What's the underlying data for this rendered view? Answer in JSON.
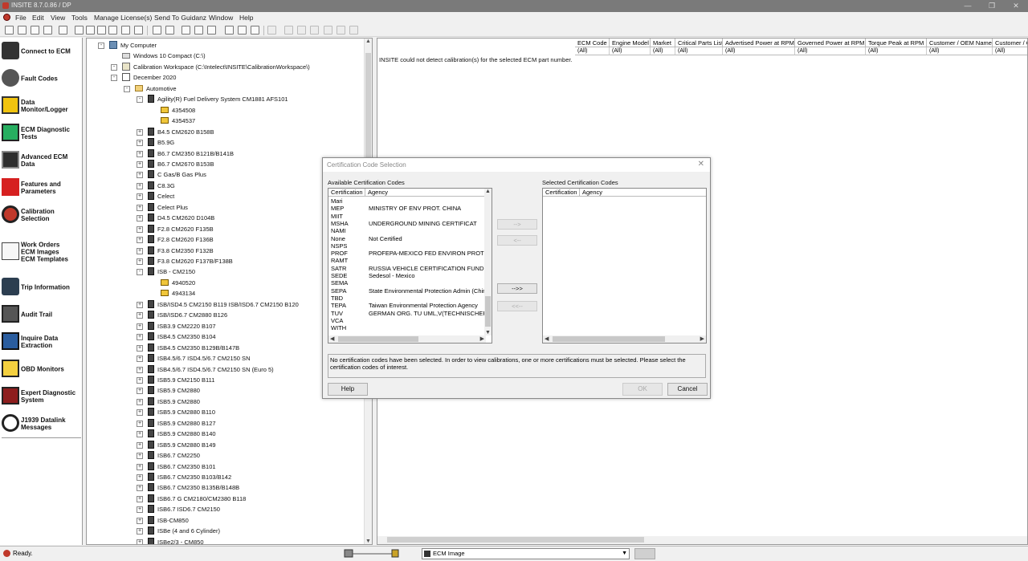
{
  "window": {
    "title": "INSITE 8.7.0.86 / DP",
    "controls": [
      "—",
      "❐",
      "✕"
    ]
  },
  "menu": [
    "File",
    "Edit",
    "View",
    "Tools",
    "Manage License(s)",
    "Send To Guidanz",
    "Window",
    "Help"
  ],
  "sidebar": [
    {
      "label": "Connect to ECM",
      "icon": "connect-ecm-icon"
    },
    {
      "label": "Fault Codes",
      "icon": "fault-codes-icon"
    },
    {
      "label": "Data\nMonitor/Logger",
      "icon": "data-monitor-icon"
    },
    {
      "label": "ECM Diagnostic\nTests",
      "icon": "ecm-diagnostic-icon"
    },
    {
      "label": "Advanced ECM\nData",
      "icon": "advanced-ecm-icon"
    },
    {
      "label": "Features and\nParameters",
      "icon": "features-icon"
    },
    {
      "label": "Calibration\nSelection",
      "icon": "calibration-icon"
    },
    {
      "label": "Work Orders\nECM Images\nECM Templates",
      "icon": "work-orders-icon"
    },
    {
      "label": "Trip Information",
      "icon": "trip-info-icon"
    },
    {
      "label": "Audit Trail",
      "icon": "audit-trail-icon"
    },
    {
      "label": "Inquire Data\nExtraction",
      "icon": "inquire-data-icon"
    },
    {
      "label": "OBD Monitors",
      "icon": "obd-monitors-icon"
    },
    {
      "label": "Expert Diagnostic\nSystem",
      "icon": "expert-diagnostic-icon"
    },
    {
      "label": "J1939 Datalink\nMessages",
      "icon": "j1939-icon"
    }
  ],
  "tree": [
    {
      "label": "My Computer",
      "level": 0,
      "icon": "comp",
      "exp": "-"
    },
    {
      "label": "Windows 10 Compact  (C:\\)",
      "level": 1,
      "icon": "drive",
      "exp": ""
    },
    {
      "label": "Calibration Workspace  (C:\\Intelect\\INSITE\\CalibrationWorkspace\\)",
      "level": 1,
      "icon": "ws",
      "exp": "-"
    },
    {
      "label": "December 2020",
      "level": 2,
      "icon": "cal",
      "exp": "-"
    },
    {
      "label": "Automotive",
      "level": 3,
      "icon": "folder",
      "exp": "-"
    },
    {
      "label": "Agility(R) Fuel Delivery System CM1881 AFS101",
      "level": 4,
      "icon": "ecm",
      "exp": "-"
    },
    {
      "label": "4354508",
      "level": 5,
      "icon": "file",
      "exp": ""
    },
    {
      "label": "4354537",
      "level": 5,
      "icon": "file",
      "exp": ""
    },
    {
      "label": "B4.5 CM2620 B158B",
      "level": 4,
      "icon": "ecm",
      "exp": "+"
    },
    {
      "label": "B5.9G",
      "level": 4,
      "icon": "ecm",
      "exp": "+"
    },
    {
      "label": "B6.7 CM2350 B121B/B141B",
      "level": 4,
      "icon": "ecm",
      "exp": "+"
    },
    {
      "label": "B6.7 CM2670 B153B",
      "level": 4,
      "icon": "ecm",
      "exp": "+"
    },
    {
      "label": "C Gas/B Gas Plus",
      "level": 4,
      "icon": "ecm",
      "exp": "+"
    },
    {
      "label": "C8.3G",
      "level": 4,
      "icon": "ecm",
      "exp": "+"
    },
    {
      "label": "Celect",
      "level": 4,
      "icon": "ecm",
      "exp": "+"
    },
    {
      "label": "Celect Plus",
      "level": 4,
      "icon": "ecm",
      "exp": "+"
    },
    {
      "label": "D4.5 CM2620 D104B",
      "level": 4,
      "icon": "ecm",
      "exp": "+"
    },
    {
      "label": "F2.8 CM2620 F135B",
      "level": 4,
      "icon": "ecm",
      "exp": "+"
    },
    {
      "label": "F2.8 CM2620 F136B",
      "level": 4,
      "icon": "ecm",
      "exp": "+"
    },
    {
      "label": "F3.8 CM2350 F132B",
      "level": 4,
      "icon": "ecm",
      "exp": "+"
    },
    {
      "label": "F3.8 CM2620 F137B/F138B",
      "level": 4,
      "icon": "ecm",
      "exp": "+"
    },
    {
      "label": "ISB - CM2150",
      "level": 4,
      "icon": "ecm",
      "exp": "-"
    },
    {
      "label": "4940520",
      "level": 5,
      "icon": "file",
      "exp": ""
    },
    {
      "label": "4943134",
      "level": 5,
      "icon": "file",
      "exp": ""
    },
    {
      "label": "ISB/ISD4.5 CM2150 B119 ISB/ISD6.7 CM2150 B120",
      "level": 4,
      "icon": "ecm",
      "exp": "+"
    },
    {
      "label": "ISB/ISD6.7 CM2880 B126",
      "level": 4,
      "icon": "ecm",
      "exp": "+"
    },
    {
      "label": "ISB3.9 CM2220 B107",
      "level": 4,
      "icon": "ecm",
      "exp": "+"
    },
    {
      "label": "ISB4.5 CM2350 B104",
      "level": 4,
      "icon": "ecm",
      "exp": "+"
    },
    {
      "label": "ISB4.5 CM2350 B129B/B147B",
      "level": 4,
      "icon": "ecm",
      "exp": "+"
    },
    {
      "label": "ISB4.5/6.7 ISD4.5/6.7 CM2150 SN",
      "level": 4,
      "icon": "ecm",
      "exp": "+"
    },
    {
      "label": "ISB4.5/6.7 ISD4.5/6.7 CM2150 SN (Euro 5)",
      "level": 4,
      "icon": "ecm",
      "exp": "+"
    },
    {
      "label": "ISB5.9 CM2150 B111",
      "level": 4,
      "icon": "ecm",
      "exp": "+"
    },
    {
      "label": "ISB5.9 CM2880",
      "level": 4,
      "icon": "ecm",
      "exp": "+"
    },
    {
      "label": "ISB5.9 CM2880",
      "level": 4,
      "icon": "ecm",
      "exp": "+"
    },
    {
      "label": "ISB5.9 CM2880 B110",
      "level": 4,
      "icon": "ecm",
      "exp": "+"
    },
    {
      "label": "ISB5.9 CM2880 B127",
      "level": 4,
      "icon": "ecm",
      "exp": "+"
    },
    {
      "label": "ISB5.9 CM2880 B140",
      "level": 4,
      "icon": "ecm",
      "exp": "+"
    },
    {
      "label": "ISB5.9 CM2880 B149",
      "level": 4,
      "icon": "ecm",
      "exp": "+"
    },
    {
      "label": "ISB6.7 CM2250",
      "level": 4,
      "icon": "ecm",
      "exp": "+"
    },
    {
      "label": "ISB6.7 CM2350 B101",
      "level": 4,
      "icon": "ecm",
      "exp": "+"
    },
    {
      "label": "ISB6.7 CM2350 B103/B142",
      "level": 4,
      "icon": "ecm",
      "exp": "+"
    },
    {
      "label": "ISB6.7 CM2350 B135B/B148B",
      "level": 4,
      "icon": "ecm",
      "exp": "+"
    },
    {
      "label": "ISB6.7 G CM2180/CM2380 B118",
      "level": 4,
      "icon": "ecm",
      "exp": "+"
    },
    {
      "label": "ISB6.7 ISD6.7 CM2150",
      "level": 4,
      "icon": "ecm",
      "exp": "+"
    },
    {
      "label": "ISB-CM850",
      "level": 4,
      "icon": "ecm",
      "exp": "+"
    },
    {
      "label": "ISBe (4 and 6 Cylinder)",
      "level": 4,
      "icon": "ecm",
      "exp": "+"
    },
    {
      "label": "ISBe2/3 - CM850",
      "level": 4,
      "icon": "ecm",
      "exp": "+"
    }
  ],
  "grid": {
    "columns": [
      "ECM Code",
      "Engine Model",
      "Market",
      "Critical Parts List",
      "Advertised Power at RPM",
      "Governed Power at RPM",
      "Torque Peak at RPM",
      "Customer / OEM Name",
      "Customer / O"
    ],
    "filter_value": "(All)",
    "message": "INSITE could not detect calibration(s) for the selected ECM part number."
  },
  "dialog": {
    "title": "Certification Code Selection",
    "close": "✕",
    "available_label": "Available Certification Codes",
    "selected_label": "Selected Certification Codes",
    "col_cert": "Certification",
    "col_agency": "Agency",
    "available": [
      {
        "code": "Mari",
        "agency": ""
      },
      {
        "code": "MEP",
        "agency": "MINISTRY OF ENV PROT. CHINA"
      },
      {
        "code": "MIIT",
        "agency": ""
      },
      {
        "code": "MSHA",
        "agency": "UNDERGROUND MINING CERTIFICAT"
      },
      {
        "code": "NAMI",
        "agency": ""
      },
      {
        "code": "None",
        "agency": "Not Certified"
      },
      {
        "code": "NSPS",
        "agency": ""
      },
      {
        "code": "PROF",
        "agency": "PROFEPA-MEXICO FED ENVIRON PROTEC"
      },
      {
        "code": "RAMT",
        "agency": ""
      },
      {
        "code": "SATR",
        "agency": "RUSSIA VEHICLE CERTIFICATION FUND"
      },
      {
        "code": "SEDE",
        "agency": "Sedesol - Mexico"
      },
      {
        "code": "SEMA",
        "agency": ""
      },
      {
        "code": "SEPA",
        "agency": "State Environmental Protection Admin (China)"
      },
      {
        "code": "TBD",
        "agency": ""
      },
      {
        "code": "TEPA",
        "agency": "Taiwan Environmental Protection Agency"
      },
      {
        "code": "TUV",
        "agency": "GERMAN ORG. TU UML,V(TECHNISCHERI"
      },
      {
        "code": "VCA",
        "agency": ""
      },
      {
        "code": "WITH",
        "agency": ""
      }
    ],
    "btn_add": "-->",
    "btn_remove": "<--",
    "btn_add_all": "-->>",
    "btn_remove_all": "<<--",
    "message": "No certification codes have been selected.  In order to view calibrations, one or more certifications must be selected.  Please select the certification codes of interest.",
    "help": "Help",
    "ok": "OK",
    "cancel": "Cancel"
  },
  "status": {
    "text": "Ready.",
    "combo_value": "ECM Image"
  }
}
